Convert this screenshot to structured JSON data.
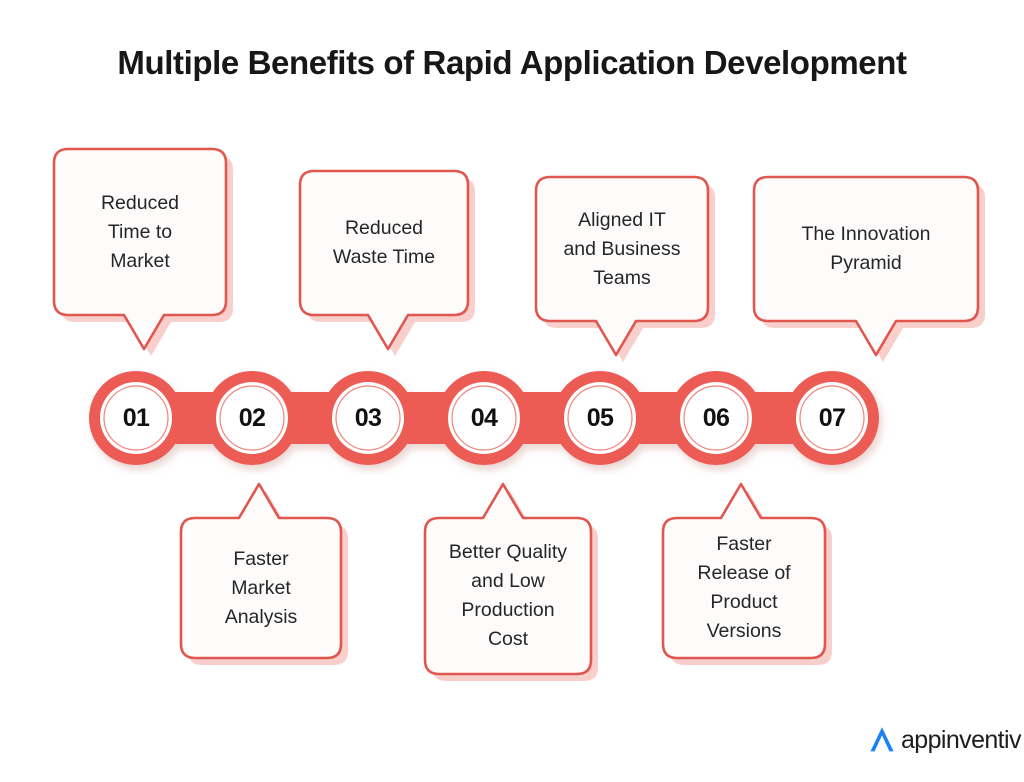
{
  "title": "Multiple Benefits of Rapid Application Development",
  "colors": {
    "background": "#ffffff",
    "accent": "#ec5b54",
    "accent_border": "#e0574f",
    "shadow_pink": "#f9cfcc",
    "bubble_fill": "#fefbfb",
    "title_text": "#17171a",
    "body_text": "#26262a",
    "number_text": "#111114",
    "logo_blue": "#1b84f2",
    "logo_text": "#1d1d1f"
  },
  "steps": [
    {
      "number": "01",
      "label": "Reduced\nTime to\nMarket",
      "position": "top"
    },
    {
      "number": "02",
      "label": "Faster\nMarket\nAnalysis",
      "position": "bottom"
    },
    {
      "number": "03",
      "label": "Reduced\nWaste Time",
      "position": "top"
    },
    {
      "number": "04",
      "label": "Better Quality\nand Low\nProduction\nCost",
      "position": "bottom"
    },
    {
      "number": "05",
      "label": "Aligned IT\nand Business\nTeams",
      "position": "top"
    },
    {
      "number": "06",
      "label": "Faster\nRelease of\nProduct\nVersions",
      "position": "bottom"
    },
    {
      "number": "07",
      "label": "The Innovation\nPyramid",
      "position": "top"
    }
  ],
  "logo": {
    "mark": "appinventiv-a-mark-icon",
    "word": "appinventiv"
  },
  "chart_data": {
    "type": "diagram",
    "diagram_style": "numbered-chain-process",
    "title": "Multiple Benefits of Rapid Application Development",
    "step_count": 7,
    "numbers": [
      "01",
      "02",
      "03",
      "04",
      "05",
      "06",
      "07"
    ],
    "labels": [
      "Reduced Time to Market",
      "Faster Market Analysis",
      "Reduced Waste Time",
      "Better Quality and Low Production Cost",
      "Aligned IT and Business Teams",
      "Faster Release of Product Versions",
      "The Innovation Pyramid"
    ],
    "label_placement": [
      "top",
      "bottom",
      "top",
      "bottom",
      "top",
      "bottom",
      "top"
    ]
  }
}
